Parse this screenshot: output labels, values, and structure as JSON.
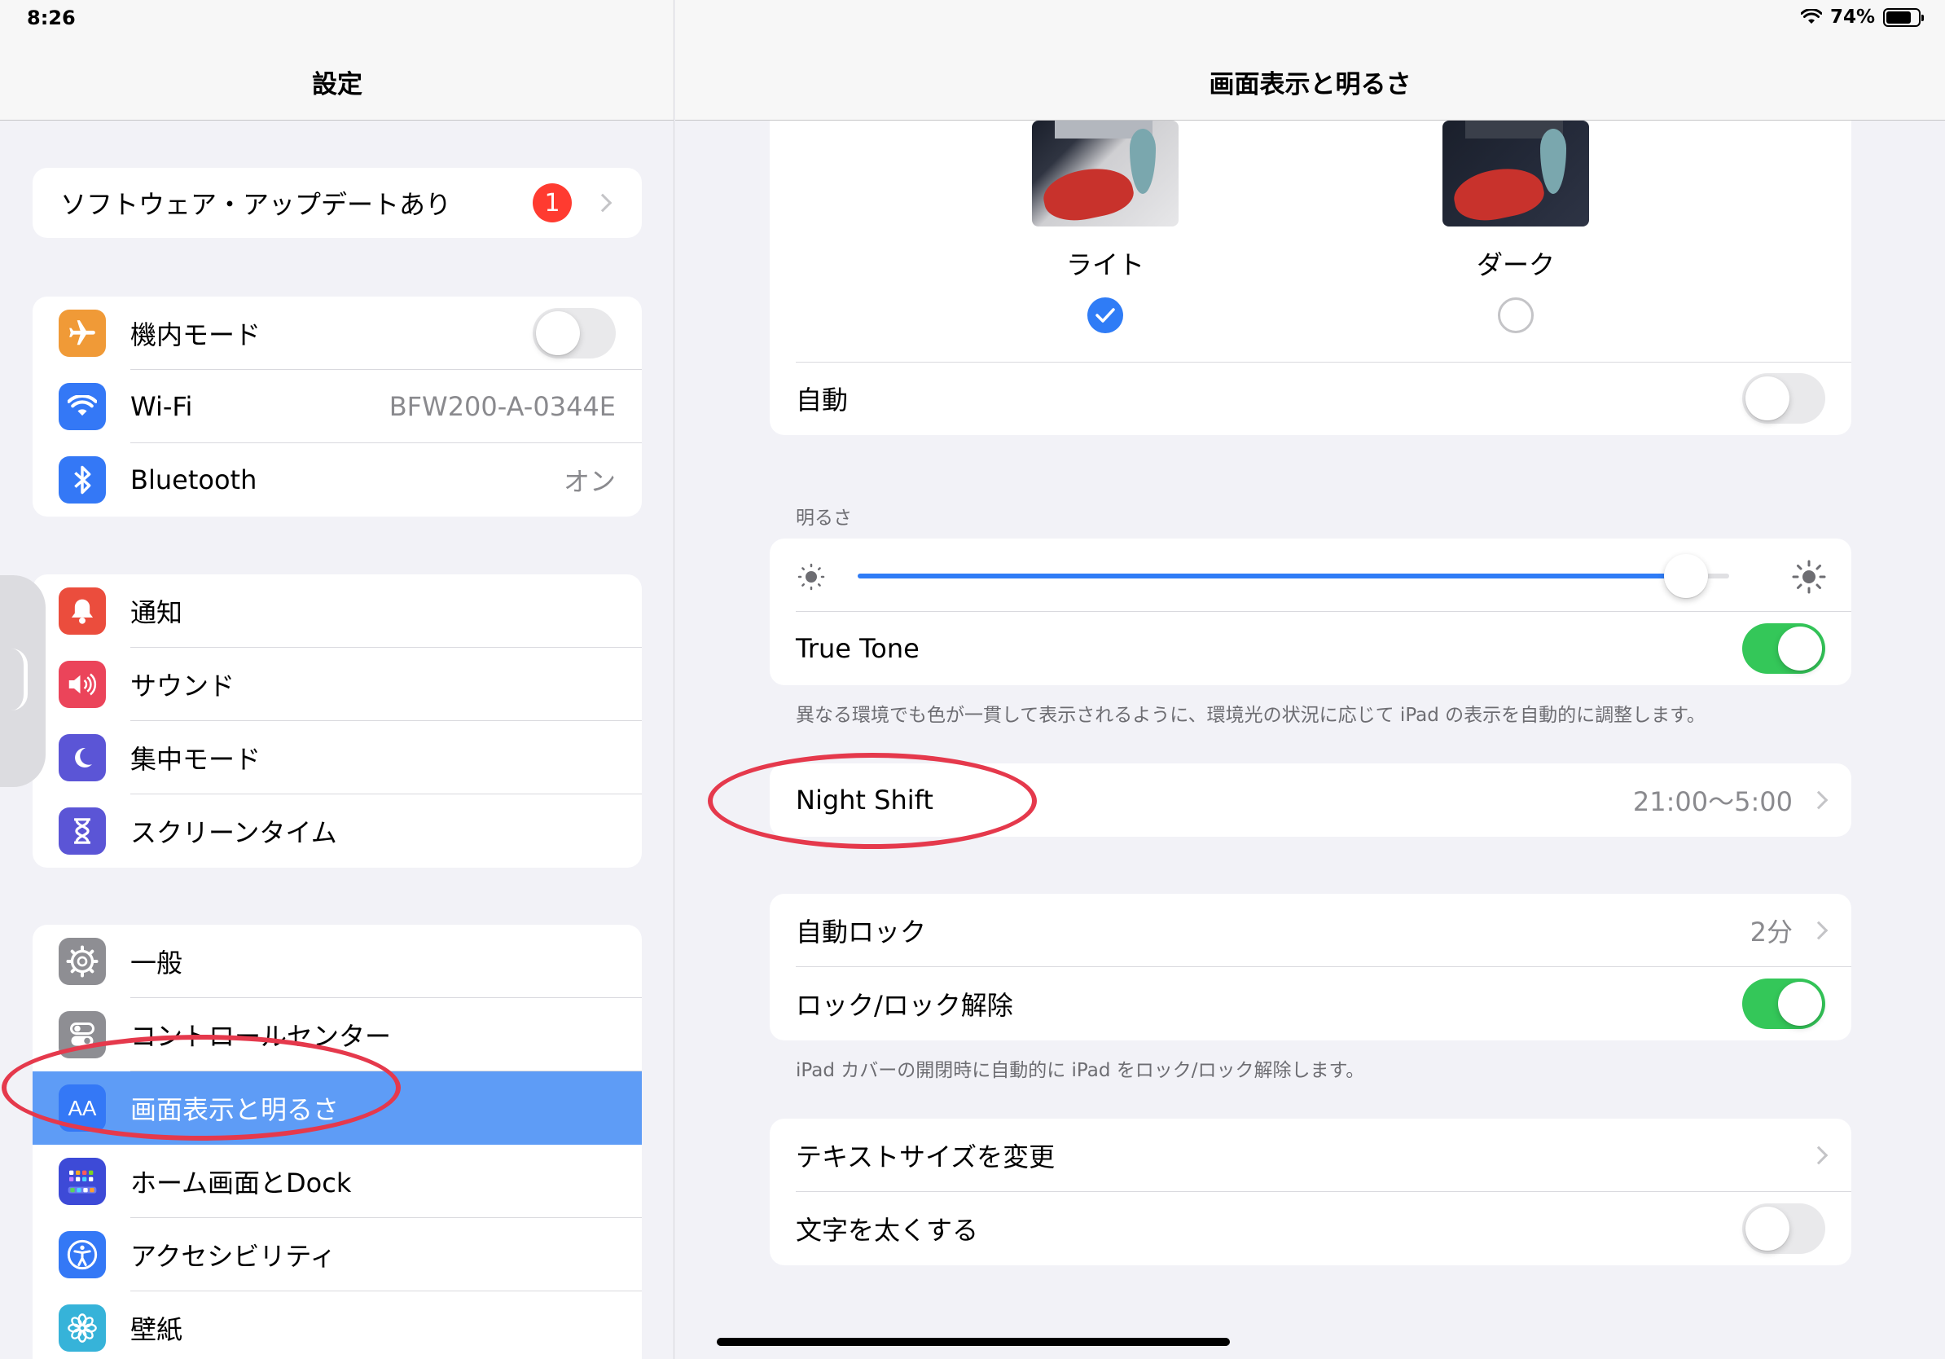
{
  "status": {
    "time": "8:26",
    "battery_text": "74%",
    "battery_level": 0.74
  },
  "sidebar": {
    "title": "設定",
    "update": {
      "label": "ソフトウェア・アップデートあり",
      "badge": "1"
    },
    "connectivity": [
      {
        "label": "機内モード",
        "icon": "airplane-icon",
        "toggle": false
      },
      {
        "label": "Wi-Fi",
        "icon": "wifi-icon",
        "value": "BFW200-A-0344E"
      },
      {
        "label": "Bluetooth",
        "icon": "bluetooth-icon",
        "value": "オン"
      }
    ],
    "notifications": [
      {
        "label": "通知",
        "icon": "bell-icon"
      },
      {
        "label": "サウンド",
        "icon": "speaker-icon"
      },
      {
        "label": "集中モード",
        "icon": "moon-icon"
      },
      {
        "label": "スクリーンタイム",
        "icon": "hourglass-icon"
      }
    ],
    "general": [
      {
        "label": "一般",
        "icon": "gear-icon"
      },
      {
        "label": "コントロールセンター",
        "icon": "switches-icon"
      },
      {
        "label": "画面表示と明るさ",
        "icon": "text-size-icon",
        "icon_text": "AA",
        "selected": true
      },
      {
        "label": "ホーム画面とDock",
        "icon": "grid-icon"
      },
      {
        "label": "アクセシビリティ",
        "icon": "accessibility-icon"
      },
      {
        "label": "壁紙",
        "icon": "flower-icon"
      }
    ]
  },
  "detail": {
    "title": "画面表示と明るさ",
    "appearance": {
      "light_label": "ライト",
      "dark_label": "ダーク",
      "selected": "light",
      "auto_label": "自動",
      "auto_toggle": false
    },
    "brightness": {
      "section_label": "明るさ",
      "level": 0.95,
      "true_tone_label": "True Tone",
      "true_tone_toggle": true,
      "footnote": "異なる環境でも色が一貫して表示されるように、環境光の状況に応じて iPad の表示を自動的に調整します。"
    },
    "night_shift": {
      "label": "Night Shift",
      "value": "21:00〜5:00"
    },
    "lock": {
      "auto_lock_label": "自動ロック",
      "auto_lock_value": "2分",
      "lock_unlock_label": "ロック/ロック解除",
      "lock_unlock_toggle": true,
      "footnote": "iPad カバーの開閉時に自動的に iPad をロック/ロック解除します。"
    },
    "text": {
      "text_size_label": "テキストサイズを変更",
      "bold_text_label": "文字を太くする",
      "bold_text_toggle": false
    }
  },
  "colors": {
    "accent": "#2f7cf6",
    "toggle_on": "#34c759",
    "selection": "#5e9cf6",
    "badge": "#ff3b30",
    "annotation": "#e5394c"
  }
}
